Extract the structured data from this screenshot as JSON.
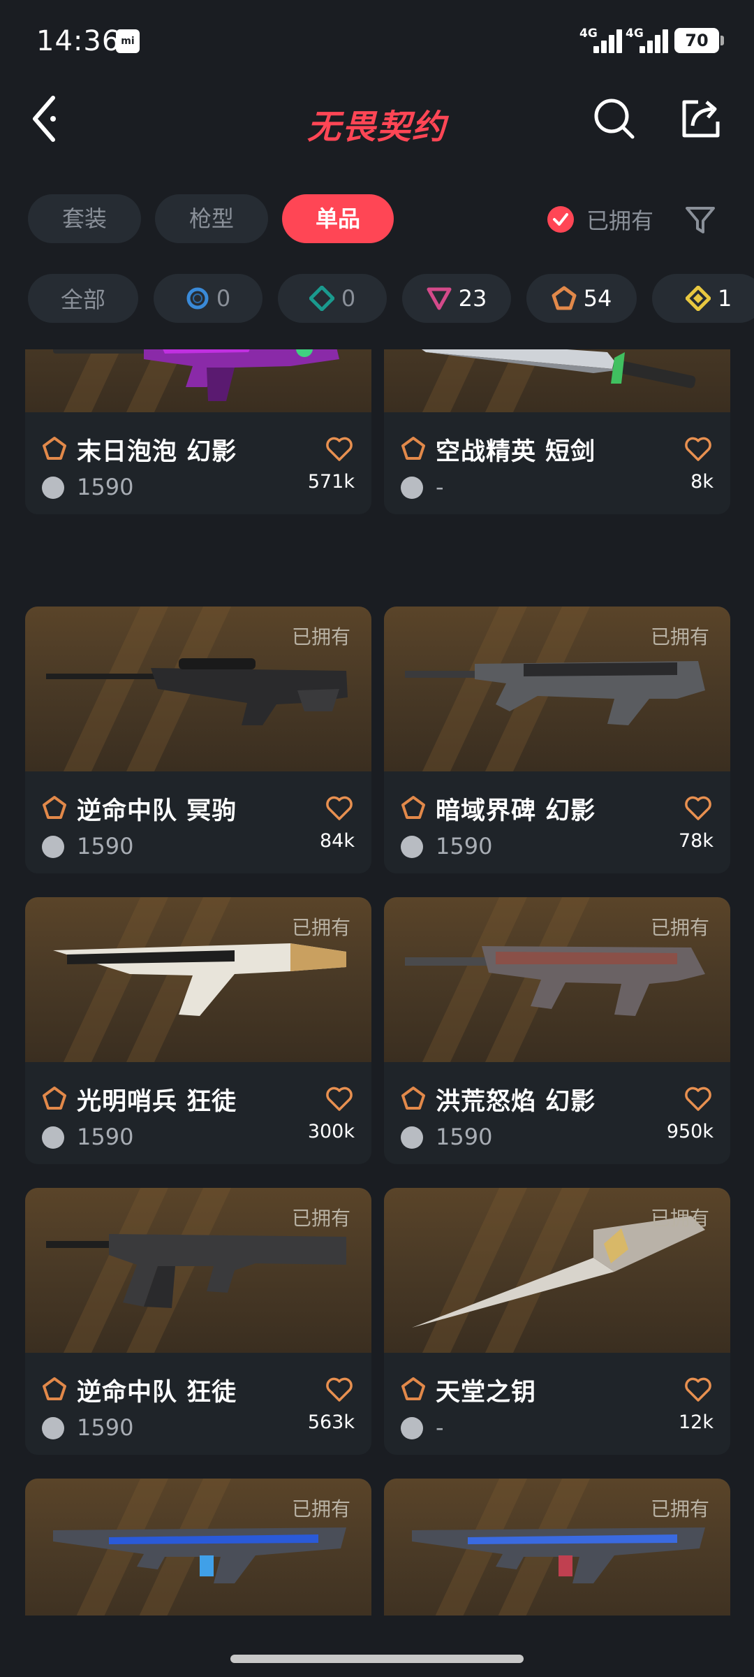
{
  "status": {
    "time": "14:36",
    "net1": "4G",
    "net2": "4G",
    "battery": "70"
  },
  "header": {
    "title": "无畏契约"
  },
  "tabs": [
    {
      "label": "套装"
    },
    {
      "label": "枪型"
    },
    {
      "label": "单品"
    }
  ],
  "owned_filter": {
    "label": "已拥有",
    "checked": true
  },
  "chips": [
    {
      "label": "全部"
    },
    {
      "count": "0",
      "icon": "blue-ring-icon"
    },
    {
      "count": "0",
      "icon": "teal-diamond-icon"
    },
    {
      "count": "23",
      "icon": "pink-triangle-icon"
    },
    {
      "count": "54",
      "icon": "orange-pentagon-icon"
    },
    {
      "count": "1",
      "icon": "gold-diamond-icon"
    }
  ],
  "owned_tag": "已拥有",
  "cards": [
    {
      "name": "末日泡泡 幻影",
      "price": "1590",
      "likes": "571k",
      "image": "purple-rifle"
    },
    {
      "name": "空战精英 短剑",
      "price": "-",
      "likes": "8k",
      "image": "silver-knife"
    },
    {
      "name": "逆命中队 冥驹",
      "price": "1590",
      "likes": "84k",
      "image": "black-sniper"
    },
    {
      "name": "暗域界碑 幻影",
      "price": "1590",
      "likes": "78k",
      "image": "dark-rifle"
    },
    {
      "name": "光明哨兵 狂徒",
      "price": "1590",
      "likes": "300k",
      "image": "gold-rifle"
    },
    {
      "name": "洪荒怒焰 幻影",
      "price": "1590",
      "likes": "950k",
      "image": "scaled-rifle"
    },
    {
      "name": "逆命中队 狂徒",
      "price": "1590",
      "likes": "563k",
      "image": "black-vandal"
    },
    {
      "name": "天堂之钥",
      "price": "-",
      "likes": "12k",
      "image": "gold-knife"
    },
    {
      "name": "",
      "price": "",
      "likes": "",
      "image": "blue-rifle"
    },
    {
      "name": "",
      "price": "",
      "likes": "",
      "image": "blue-rifle-2"
    }
  ]
}
